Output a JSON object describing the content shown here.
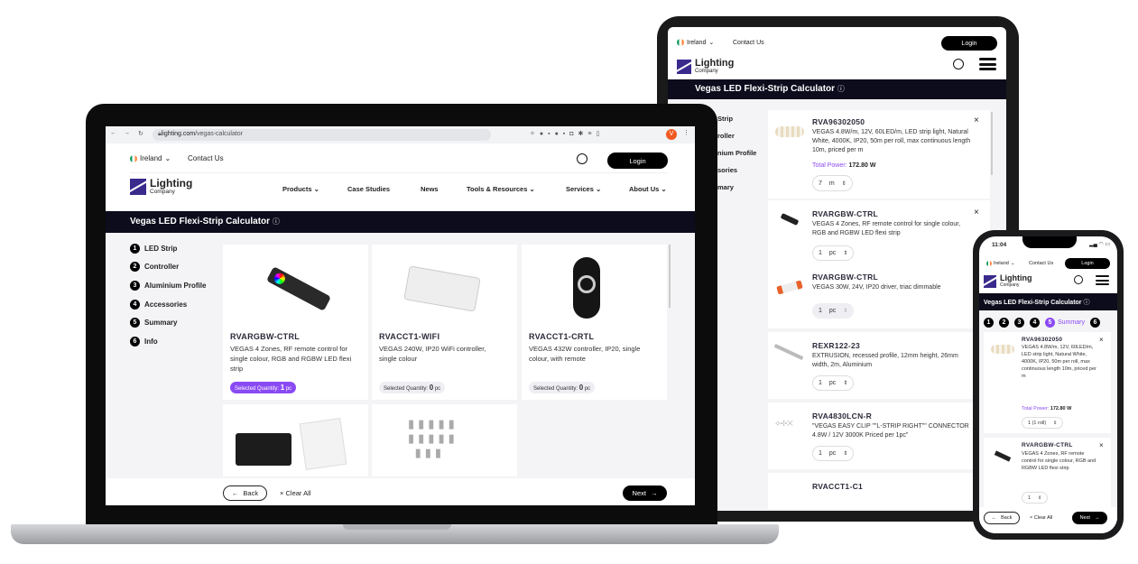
{
  "site": {
    "country": "Ireland",
    "contact": "Contact Us",
    "login": "Login",
    "logo_main": "Lighting",
    "logo_sub": "Company",
    "page_title": "Vegas LED Flexi-Strip Calculator",
    "nav": [
      "Products",
      "Case Studies",
      "News",
      "Tools & Resources",
      "Services",
      "About Us"
    ],
    "steps": [
      "LED Strip",
      "Controller",
      "Aluminium Profile",
      "Accessories",
      "Summary",
      "Info"
    ],
    "back": "Back",
    "clear_all": "Clear All",
    "next": "Next",
    "accent": "#8a4af3",
    "header_bg": "#0d0c1d"
  },
  "laptop": {
    "browser": {
      "url_host": "lighting.com",
      "url_path": "/vegas-calculator",
      "profile_initial": "V"
    },
    "products": [
      {
        "sku": "RVARGBW-CTRL",
        "desc": "VEGAS 4 Zones, RF remote control for single colour, RGB and RGBW LED flexi strip",
        "qty_label": "Selected Quantity:",
        "qty": "1",
        "unit": "pc",
        "selected": true
      },
      {
        "sku": "RVACCT1-WIFI",
        "desc": "VEGAS 240W, IP20 WiFi controller, single colour",
        "qty_label": "Selected Quantity:",
        "qty": "0",
        "unit": "pc",
        "selected": false
      },
      {
        "sku": "RVACCT1-CRTL",
        "desc": "VEGAS 432W controller, IP20, single colour, with remote",
        "qty_label": "Selected Quantity:",
        "qty": "0",
        "unit": "pc",
        "selected": false
      }
    ]
  },
  "tablet": {
    "steps_partial": [
      "Strip",
      "roller",
      "nium Profile",
      "sories",
      "mary"
    ],
    "items": [
      {
        "sku": "RVA96302050",
        "desc": "VEGAS 4.8W/m, 12V, 60LED/m, LED strip light, Natural White, 4000K, IP20, 50m per roll, max continuous length 10m, priced per m",
        "power_label": "Total Power:",
        "power": "172.80 W",
        "qty": "7",
        "unit": "m"
      },
      {
        "sku": "RVARGBW-CTRL",
        "desc": "VEGAS 4 Zones, RF remote control for single colour, RGB and RGBW LED flexi strip",
        "qty": "1",
        "unit": "pc"
      },
      {
        "sku": "RVARGBW-CTRL",
        "desc": "VEGAS 30W, 24V, IP20 driver, triac dimmable",
        "qty": "1",
        "unit": "pc"
      },
      {
        "sku": "REXR122-23",
        "desc": "EXTRUSION, recessed profile, 12mm height, 26mm width, 2m, Aluminium",
        "qty": "1",
        "unit": "pc"
      },
      {
        "sku": "RVA4830LCN-R",
        "desc": "\"VEGAS EASY CLIP \"\"L-STRIP RIGHT\"\" CONNECTOR 4.8W / 12V 3000K Priced per 1pc\"",
        "qty": "1",
        "unit": "pc"
      },
      {
        "sku": "RVACCT1-C1"
      }
    ]
  },
  "phone": {
    "time": "11:04",
    "steps": [
      "1",
      "2",
      "3",
      "4",
      "5",
      "6"
    ],
    "active_step_label": "Summary",
    "items": [
      {
        "sku": "RVA96302050",
        "desc": "VEGAS 4.8W/m, 12V, 60LED/m, LED strip light, Natural White, 4000K, IP20, 50m per roll, max continuous length 10m, priced per m",
        "power_label": "Total Power:",
        "power": "172.80 W",
        "qty": "1 (1 roll)"
      },
      {
        "sku": "RVARGBW-CTRL",
        "desc": "VEGAS 4 Zones, RF remote control for single colour, RGB and RGBW LED flexi strip",
        "qty": "1"
      }
    ]
  }
}
